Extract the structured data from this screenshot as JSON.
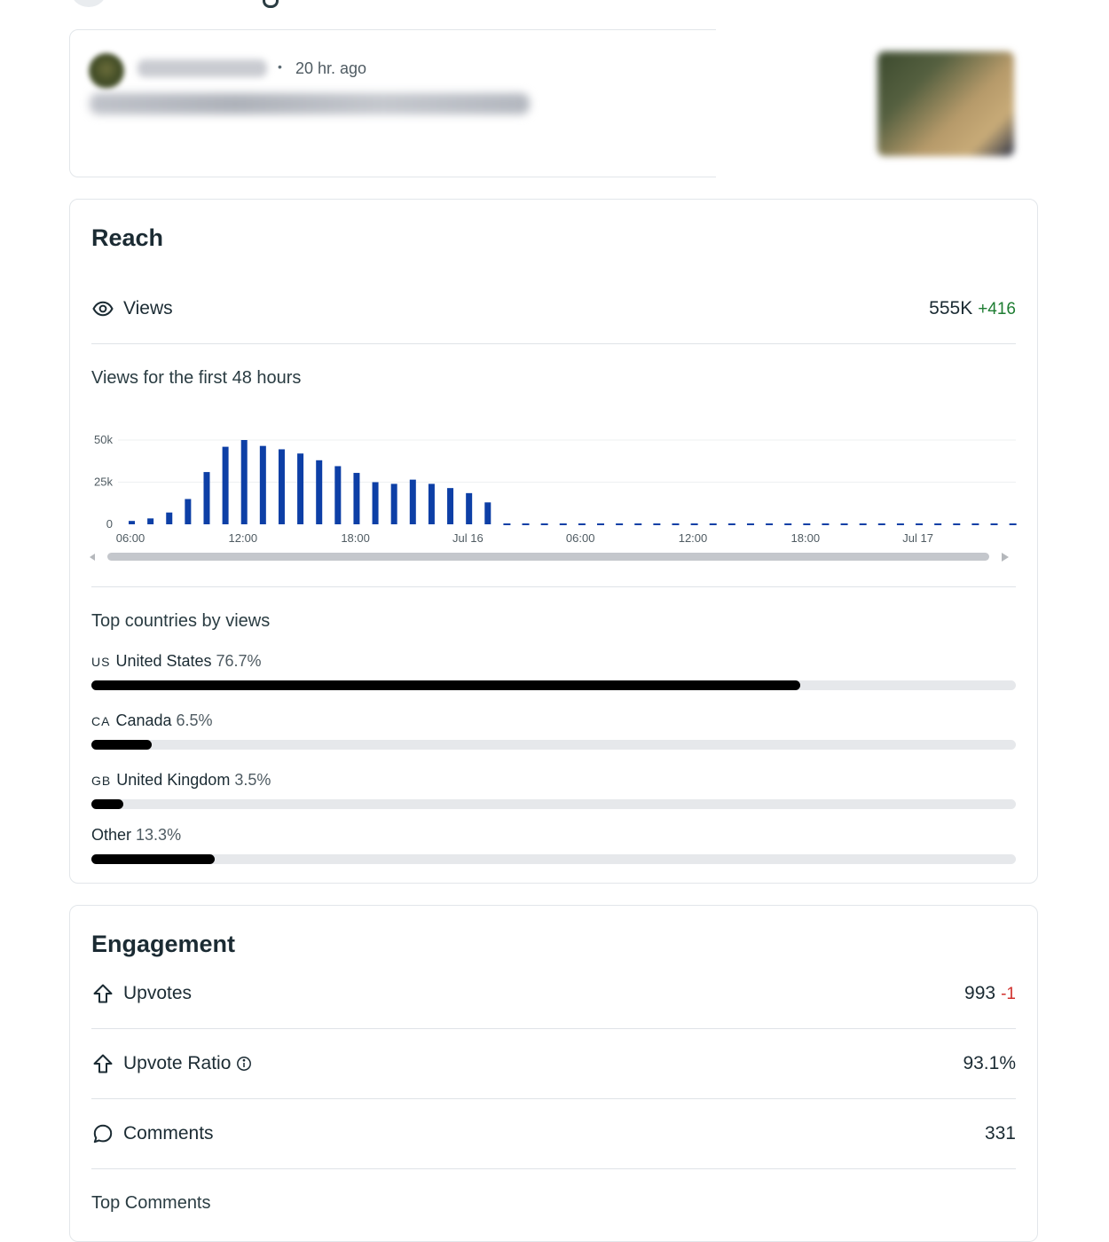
{
  "post": {
    "time": "20 hr. ago",
    "separator": "•"
  },
  "reach": {
    "title": "Reach",
    "views": {
      "label": "Views",
      "value": "555K",
      "delta": "+416",
      "icon": "eye-icon"
    },
    "chart_title": "Views for the first 48 hours",
    "top_countries_label": "Top countries by views",
    "countries": [
      {
        "code": "US",
        "name": "United States",
        "pct": "76.7%",
        "share": 0.767
      },
      {
        "code": "CA",
        "name": "Canada",
        "pct": "6.5%",
        "share": 0.065
      },
      {
        "code": "GB",
        "name": "United Kingdom",
        "pct": "3.5%",
        "share": 0.035
      },
      {
        "code": "",
        "name": "Other",
        "pct": "13.3%",
        "share": 0.133
      }
    ]
  },
  "engagement": {
    "title": "Engagement",
    "upvotes": {
      "label": "Upvotes",
      "value": "993",
      "delta": "-1",
      "icon": "upvote-arrow-icon"
    },
    "upvote_ratio": {
      "label": "Upvote Ratio",
      "value": "93.1%",
      "icon": "upvote-arrow-icon"
    },
    "comments": {
      "label": "Comments",
      "value": "331",
      "icon": "comment-bubble-icon"
    },
    "top_comments_label": "Top Comments"
  },
  "colors": {
    "bar": "#0d3fa6",
    "positive": "#1e7d32",
    "negative": "#d0312d",
    "fill": "#000000",
    "track": "#e6e8eb"
  },
  "chart_data": {
    "type": "bar",
    "title": "Views for the first 48 hours",
    "x_ticks": [
      "06:00",
      "12:00",
      "18:00",
      "Jul 16",
      "06:00",
      "12:00",
      "18:00",
      "Jul 17"
    ],
    "y_ticks": [
      "0",
      "25k",
      "50k"
    ],
    "ylim": [
      0,
      50000
    ],
    "series": [
      {
        "values": [
          2000,
          3500,
          7000,
          15000,
          31000,
          46000,
          50000,
          46500,
          44500,
          42000,
          38000,
          34500,
          30500,
          25000,
          24000,
          26500,
          24000,
          21500,
          18500,
          13000
        ]
      }
    ],
    "pending_hours": 28,
    "grid": true,
    "scrollbar": true
  }
}
